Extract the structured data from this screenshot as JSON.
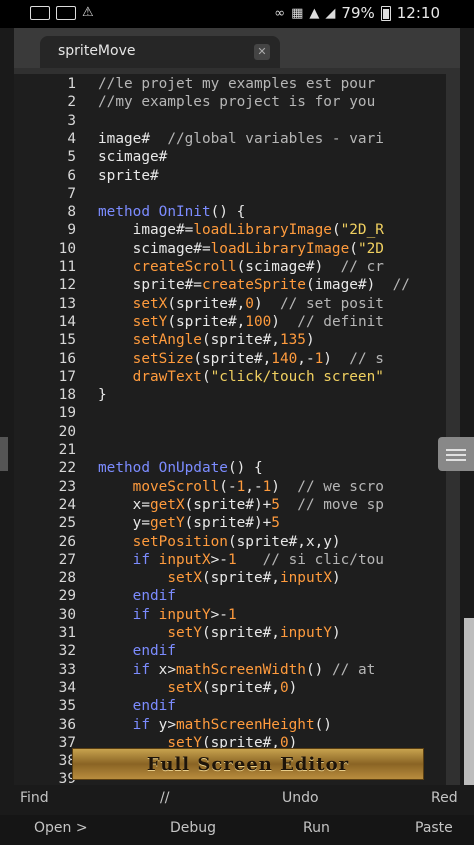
{
  "status_bar": {
    "battery": "79%",
    "time": "12:10",
    "icons": [
      "mail-icon",
      "image-icon",
      "alert-icon",
      "bluetooth-icon",
      "vibrate-icon",
      "wifi-icon",
      "signal-icon",
      "battery-icon"
    ]
  },
  "tab": {
    "title": "spriteMove"
  },
  "editor": {
    "lines": [
      {
        "n": "1",
        "segs": [
          {
            "t": "comment",
            "s": "//le projet my examples est pour"
          }
        ]
      },
      {
        "n": "2",
        "segs": [
          {
            "t": "comment",
            "s": "//my examples project is for you"
          }
        ]
      },
      {
        "n": "3",
        "segs": []
      },
      {
        "n": "4",
        "segs": [
          {
            "t": "normal",
            "s": "image#  "
          },
          {
            "t": "comment",
            "s": "//global variables - vari"
          }
        ]
      },
      {
        "n": "5",
        "segs": [
          {
            "t": "normal",
            "s": "scimage#"
          }
        ]
      },
      {
        "n": "6",
        "segs": [
          {
            "t": "normal",
            "s": "sprite#"
          }
        ]
      },
      {
        "n": "7",
        "segs": []
      },
      {
        "n": "8",
        "segs": [
          {
            "t": "keyword",
            "s": "method "
          },
          {
            "t": "keyword",
            "s": "OnInit"
          },
          {
            "t": "normal",
            "s": "() {"
          }
        ]
      },
      {
        "n": "9",
        "segs": [
          {
            "t": "normal",
            "s": "    image#="
          },
          {
            "t": "func",
            "s": "loadLibraryImage"
          },
          {
            "t": "normal",
            "s": "("
          },
          {
            "t": "string",
            "s": "\"2D_R"
          }
        ]
      },
      {
        "n": "10",
        "segs": [
          {
            "t": "normal",
            "s": "    scimage#="
          },
          {
            "t": "func",
            "s": "loadLibraryImage"
          },
          {
            "t": "normal",
            "s": "("
          },
          {
            "t": "string",
            "s": "\"2D"
          }
        ]
      },
      {
        "n": "11",
        "segs": [
          {
            "t": "normal",
            "s": "    "
          },
          {
            "t": "func",
            "s": "createScroll"
          },
          {
            "t": "normal",
            "s": "(scimage#)  "
          },
          {
            "t": "comment",
            "s": "// cr"
          }
        ]
      },
      {
        "n": "12",
        "segs": [
          {
            "t": "normal",
            "s": "    sprite#="
          },
          {
            "t": "func",
            "s": "createSprite"
          },
          {
            "t": "normal",
            "s": "(image#)  "
          },
          {
            "t": "comment",
            "s": "//"
          }
        ]
      },
      {
        "n": "13",
        "segs": [
          {
            "t": "normal",
            "s": "    "
          },
          {
            "t": "func",
            "s": "setX"
          },
          {
            "t": "normal",
            "s": "(sprite#,"
          },
          {
            "t": "number",
            "s": "0"
          },
          {
            "t": "normal",
            "s": ")  "
          },
          {
            "t": "comment",
            "s": "// set posit"
          }
        ]
      },
      {
        "n": "14",
        "segs": [
          {
            "t": "normal",
            "s": "    "
          },
          {
            "t": "func",
            "s": "setY"
          },
          {
            "t": "normal",
            "s": "(sprite#,"
          },
          {
            "t": "number",
            "s": "100"
          },
          {
            "t": "normal",
            "s": ")  "
          },
          {
            "t": "comment",
            "s": "// definit"
          }
        ]
      },
      {
        "n": "15",
        "segs": [
          {
            "t": "normal",
            "s": "    "
          },
          {
            "t": "func",
            "s": "setAngle"
          },
          {
            "t": "normal",
            "s": "(sprite#,"
          },
          {
            "t": "number",
            "s": "135"
          },
          {
            "t": "normal",
            "s": ")"
          }
        ]
      },
      {
        "n": "16",
        "segs": [
          {
            "t": "normal",
            "s": "    "
          },
          {
            "t": "func",
            "s": "setSize"
          },
          {
            "t": "normal",
            "s": "(sprite#,"
          },
          {
            "t": "number",
            "s": "140"
          },
          {
            "t": "normal",
            "s": ",-"
          },
          {
            "t": "number",
            "s": "1"
          },
          {
            "t": "normal",
            "s": ")  "
          },
          {
            "t": "comment",
            "s": "// s"
          }
        ]
      },
      {
        "n": "17",
        "segs": [
          {
            "t": "normal",
            "s": "    "
          },
          {
            "t": "func",
            "s": "drawText"
          },
          {
            "t": "normal",
            "s": "("
          },
          {
            "t": "string",
            "s": "\"click/touch screen\""
          }
        ]
      },
      {
        "n": "18",
        "segs": [
          {
            "t": "normal",
            "s": "}"
          }
        ]
      },
      {
        "n": "19",
        "segs": []
      },
      {
        "n": "20",
        "segs": []
      },
      {
        "n": "21",
        "segs": []
      },
      {
        "n": "22",
        "segs": [
          {
            "t": "keyword",
            "s": "method "
          },
          {
            "t": "keyword",
            "s": "OnUpdate"
          },
          {
            "t": "normal",
            "s": "() {"
          }
        ]
      },
      {
        "n": "23",
        "segs": [
          {
            "t": "normal",
            "s": "    "
          },
          {
            "t": "func",
            "s": "moveScroll"
          },
          {
            "t": "normal",
            "s": "(-"
          },
          {
            "t": "number",
            "s": "1"
          },
          {
            "t": "normal",
            "s": ",-"
          },
          {
            "t": "number",
            "s": "1"
          },
          {
            "t": "normal",
            "s": ")  "
          },
          {
            "t": "comment",
            "s": "// we scro"
          }
        ]
      },
      {
        "n": "24",
        "segs": [
          {
            "t": "normal",
            "s": "    x="
          },
          {
            "t": "func",
            "s": "getX"
          },
          {
            "t": "normal",
            "s": "(sprite#)+"
          },
          {
            "t": "number",
            "s": "5"
          },
          {
            "t": "normal",
            "s": "  "
          },
          {
            "t": "comment",
            "s": "// move sp"
          }
        ]
      },
      {
        "n": "25",
        "segs": [
          {
            "t": "normal",
            "s": "    y="
          },
          {
            "t": "func",
            "s": "getY"
          },
          {
            "t": "normal",
            "s": "(sprite#)+"
          },
          {
            "t": "number",
            "s": "5"
          }
        ]
      },
      {
        "n": "26",
        "segs": [
          {
            "t": "normal",
            "s": "    "
          },
          {
            "t": "func",
            "s": "setPosition"
          },
          {
            "t": "normal",
            "s": "(sprite#,x,y)"
          }
        ]
      },
      {
        "n": "27",
        "segs": [
          {
            "t": "normal",
            "s": "    "
          },
          {
            "t": "keyword",
            "s": "if "
          },
          {
            "t": "func",
            "s": "inputX"
          },
          {
            "t": "normal",
            "s": ">-"
          },
          {
            "t": "number",
            "s": "1"
          },
          {
            "t": "normal",
            "s": "   "
          },
          {
            "t": "comment",
            "s": "// si clic/tou"
          }
        ]
      },
      {
        "n": "28",
        "segs": [
          {
            "t": "normal",
            "s": "        "
          },
          {
            "t": "func",
            "s": "setX"
          },
          {
            "t": "normal",
            "s": "(sprite#,"
          },
          {
            "t": "func",
            "s": "inputX"
          },
          {
            "t": "normal",
            "s": ")"
          }
        ]
      },
      {
        "n": "29",
        "segs": [
          {
            "t": "normal",
            "s": "    "
          },
          {
            "t": "keyword",
            "s": "endif"
          }
        ]
      },
      {
        "n": "30",
        "segs": [
          {
            "t": "normal",
            "s": "    "
          },
          {
            "t": "keyword",
            "s": "if "
          },
          {
            "t": "func",
            "s": "inputY"
          },
          {
            "t": "normal",
            "s": ">-"
          },
          {
            "t": "number",
            "s": "1"
          }
        ]
      },
      {
        "n": "31",
        "segs": [
          {
            "t": "normal",
            "s": "        "
          },
          {
            "t": "func",
            "s": "setY"
          },
          {
            "t": "normal",
            "s": "(sprite#,"
          },
          {
            "t": "func",
            "s": "inputY"
          },
          {
            "t": "normal",
            "s": ")"
          }
        ]
      },
      {
        "n": "32",
        "segs": [
          {
            "t": "normal",
            "s": "    "
          },
          {
            "t": "keyword",
            "s": "endif"
          }
        ]
      },
      {
        "n": "33",
        "segs": [
          {
            "t": "normal",
            "s": "    "
          },
          {
            "t": "keyword",
            "s": "if "
          },
          {
            "t": "normal",
            "s": "x>"
          },
          {
            "t": "func",
            "s": "mathScreenWidth"
          },
          {
            "t": "normal",
            "s": "() "
          },
          {
            "t": "comment",
            "s": "// at"
          }
        ]
      },
      {
        "n": "34",
        "segs": [
          {
            "t": "normal",
            "s": "        "
          },
          {
            "t": "func",
            "s": "setX"
          },
          {
            "t": "normal",
            "s": "(sprite#,"
          },
          {
            "t": "number",
            "s": "0"
          },
          {
            "t": "normal",
            "s": ")"
          }
        ]
      },
      {
        "n": "35",
        "segs": [
          {
            "t": "normal",
            "s": "    "
          },
          {
            "t": "keyword",
            "s": "endif"
          }
        ]
      },
      {
        "n": "36",
        "segs": [
          {
            "t": "normal",
            "s": "    "
          },
          {
            "t": "keyword",
            "s": "if "
          },
          {
            "t": "normal",
            "s": "y>"
          },
          {
            "t": "func",
            "s": "mathScreenHeight"
          },
          {
            "t": "normal",
            "s": "()"
          }
        ]
      },
      {
        "n": "37",
        "segs": [
          {
            "t": "normal",
            "s": "        "
          },
          {
            "t": "func",
            "s": "setY"
          },
          {
            "t": "normal",
            "s": "(sprite#,"
          },
          {
            "t": "number",
            "s": "0"
          },
          {
            "t": "normal",
            "s": ")"
          }
        ]
      },
      {
        "n": "38",
        "segs": []
      },
      {
        "n": "39",
        "segs": []
      }
    ]
  },
  "banner": {
    "text": "Full Screen Editor"
  },
  "toolbar_top": {
    "find": "Find",
    "comment": "//",
    "undo": "Undo",
    "redo": "Red"
  },
  "toolbar_bottom": {
    "open": "Open >",
    "debug": "Debug",
    "run": "Run",
    "paste": "Paste"
  },
  "colors": {
    "keyword": "#7c8cff",
    "function": "#ff9b3d",
    "string": "#f0d060",
    "comment": "#b6b6b6",
    "banner_gold": "#b98d3e"
  }
}
